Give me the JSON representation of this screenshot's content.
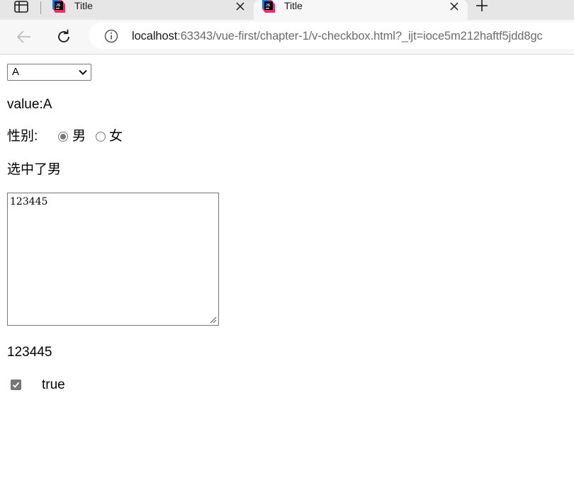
{
  "browser": {
    "tabs": [
      {
        "title": "Title",
        "active": false
      },
      {
        "title": "Title",
        "active": true
      }
    ],
    "address": {
      "host": "localhost",
      "rest": ":63343/vue-first/chapter-1/v-checkbox.html?_ijt=ioce5m212haftf5jdd8gc"
    }
  },
  "page": {
    "select": {
      "selected": "A"
    },
    "value_line": "value:A",
    "gender": {
      "label": "性别:",
      "options": [
        {
          "label": "男",
          "checked": true
        },
        {
          "label": "女",
          "checked": false
        }
      ]
    },
    "selected_line": "选中了男",
    "textarea": {
      "value": "123445"
    },
    "echo_line": "123445",
    "checkbox": {
      "checked": true,
      "label": "true"
    }
  },
  "colors": {
    "control_border": "#767676",
    "tab_strip": "#e6e6e6",
    "toolbar": "#f7f7f7"
  }
}
